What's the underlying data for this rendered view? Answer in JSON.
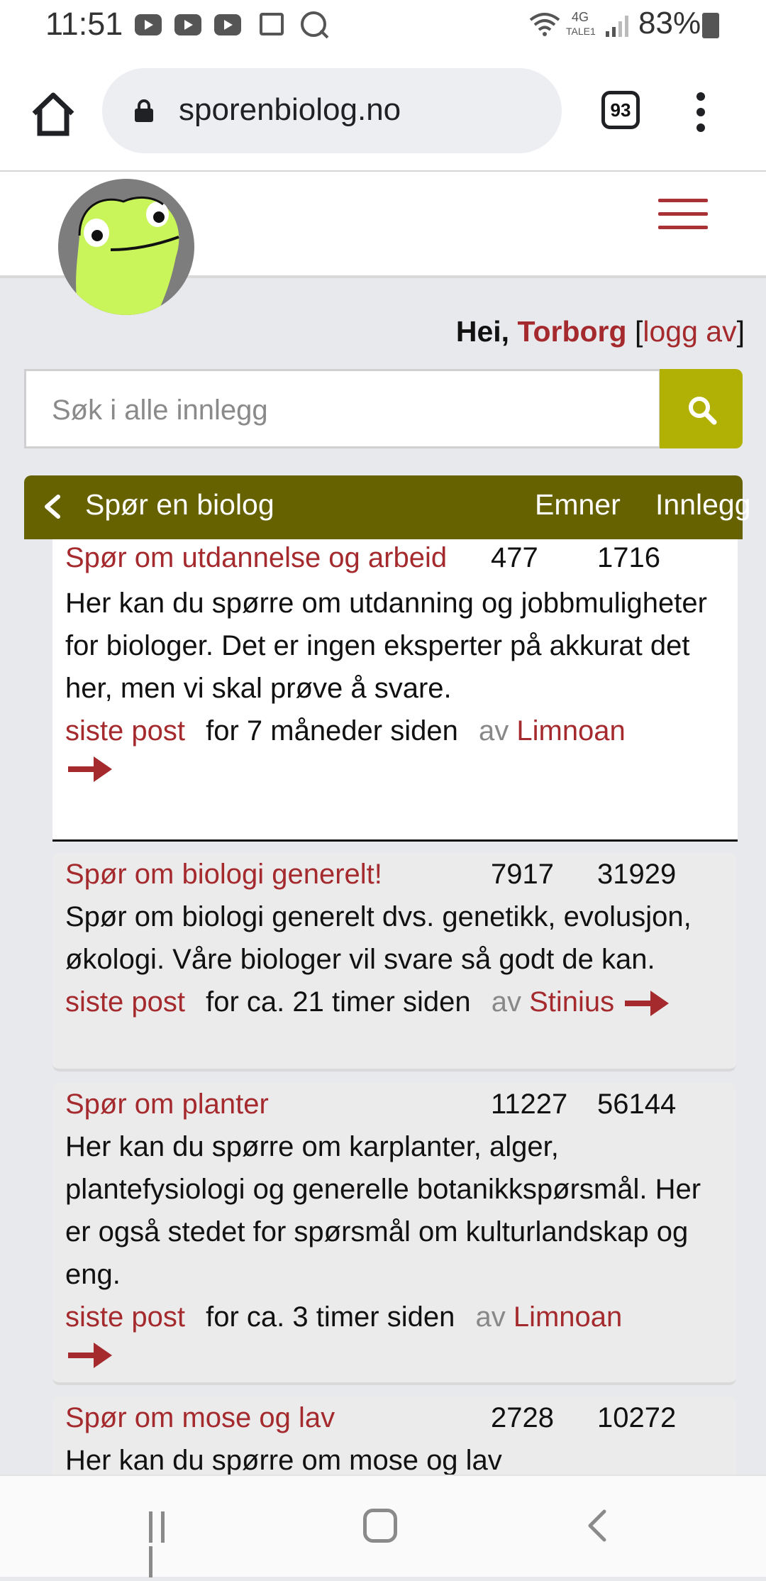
{
  "status_bar": {
    "time": "11:51",
    "network": "4G",
    "network_sub": "TALE1",
    "battery": "83%",
    "icons": [
      "youtube-icon",
      "youtube-icon",
      "youtube-icon",
      "image-icon",
      "search-icon",
      "wifi-icon",
      "signal-icon",
      "battery-icon"
    ]
  },
  "browser": {
    "url": "sporenbiolog.no",
    "tab_count": "93",
    "icons": [
      "home-icon",
      "lock-icon",
      "more-vert-icon"
    ]
  },
  "site": {
    "logo": "frog-avatar-logo",
    "menu_icon": "hamburger-icon",
    "accent": "#a52a2e",
    "header_bar_color": "#666200",
    "search_button_color": "#b1b105"
  },
  "greeting": {
    "hello": "Hei,",
    "user": "Torborg",
    "open_bracket": "[",
    "logout": "logg av",
    "close_bracket": "]"
  },
  "search": {
    "placeholder": "Søk i alle innlegg",
    "icon": "search-icon"
  },
  "forum": {
    "title": "Spør en biolog",
    "col_topics": "Emner",
    "col_posts": "Innlegg",
    "last_post_label": "siste post",
    "by_label": "av",
    "categories": [
      {
        "title": "Spør om utdannelse og arbeid",
        "topics": "477",
        "posts": "1716",
        "description": "Her kan du spørre om utdanning og jobbmuligheter for biologer. Det er ingen eksperter på akkurat det her, men vi skal prøve å svare.",
        "last_post_time": "for 7 måneder siden",
        "last_post_author": "Limnoan"
      },
      {
        "title": "Spør om biologi generelt!",
        "topics": "7917",
        "posts": "31929",
        "description": "Spør om biologi generelt dvs. genetikk, evolusjon, økologi. Våre biologer vil svare så godt de kan.",
        "last_post_time": "for ca. 21 timer siden",
        "last_post_author": "Stinius"
      },
      {
        "title": "Spør om planter",
        "topics": "11227",
        "posts": "56144",
        "description": "Her kan du spørre om karplanter, alger, plantefysiologi og generelle botanikkspørsmål. Her er også stedet for spørsmål om kulturlandskap og eng.",
        "last_post_time": "for ca. 3 timer siden",
        "last_post_author": "Limnoan"
      },
      {
        "title": "Spør om mose og lav",
        "topics": "2728",
        "posts": "10272",
        "description": "Her kan du spørre om mose og lav"
      }
    ]
  },
  "navbar": {
    "icons": [
      "recent-apps-icon",
      "home-nav-icon",
      "back-nav-icon"
    ]
  }
}
